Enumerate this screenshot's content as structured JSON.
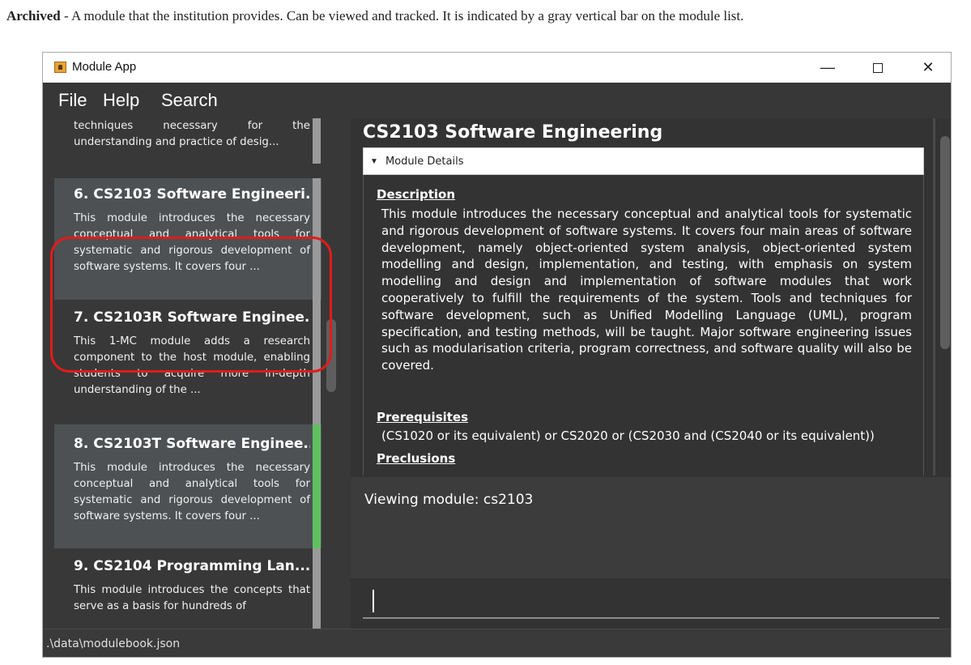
{
  "doc": {
    "term": "Archived",
    "definition": " - A module that the institution provides. Can be viewed and tracked. It is indicated by a gray vertical bar on the module list."
  },
  "window": {
    "title": "Module App",
    "minimize_glyph": "—",
    "close_glyph": "✕",
    "icon": "app-icon"
  },
  "menu": {
    "file": "File",
    "help": "Help",
    "search": "Search"
  },
  "module_list": [
    {
      "title": "",
      "desc": "techniques necessary for the understanding and practice of desig...",
      "bar": "gray"
    },
    {
      "title": "6. CS2103 Software Engineeri...",
      "desc": "This module introduces the necessary conceptual and analytical tools for systematic and rigorous development of software systems. It covers four ...",
      "bar": "gray",
      "selected": true
    },
    {
      "title": "7. CS2103R Software Enginee...",
      "desc": "This 1-MC module adds a research component to the host module, enabling students to acquire more in-depth understanding of the ...",
      "bar": "gray"
    },
    {
      "title": "8. CS2103T Software Enginee...",
      "desc": "This module introduces the necessary conceptual and analytical tools for systematic and rigorous development of software systems. It covers four ...",
      "bar": "green"
    },
    {
      "title": "9. CS2104 Programming Lan...",
      "desc": "This module introduces the concepts that serve as a basis for hundreds of",
      "bar": "gray"
    }
  ],
  "details": {
    "module_title": "CS2103 Software Engineering",
    "section_toggle_glyph": "▼",
    "section_label": "Module Details",
    "description_heading": "Description",
    "description": "This module introduces the necessary conceptual and analytical tools for systematic and rigorous development of software systems. It covers four main areas of software development, namely object-oriented system analysis, object-oriented system modelling and design, implementation, and testing, with emphasis on system modelling and design and implementation of software modules that work cooperatively to fulfill the requirements of the system. Tools and techniques for software development, such as Unified Modelling Language (UML), program specification, and testing methods, will be taught. Major software engineering issues such as modularisation criteria, program correctness, and software quality will also be covered.",
    "prerequisites_heading": "Prerequisites",
    "prerequisites": "(CS1020 or its equivalent) or CS2020 or (CS2030 and (CS2040 or its equivalent))",
    "preclusions_heading": "Preclusions"
  },
  "result_display": "Viewing module: cs2103",
  "command_box": {
    "value": ""
  },
  "status_bar": ".\\data\\modulebook.json",
  "colors": {
    "archived_bar": "#9a9a9a",
    "tracked_bar": "#60c060",
    "highlight_ring": "#e21b1b",
    "selected_card": "#4d5154"
  }
}
